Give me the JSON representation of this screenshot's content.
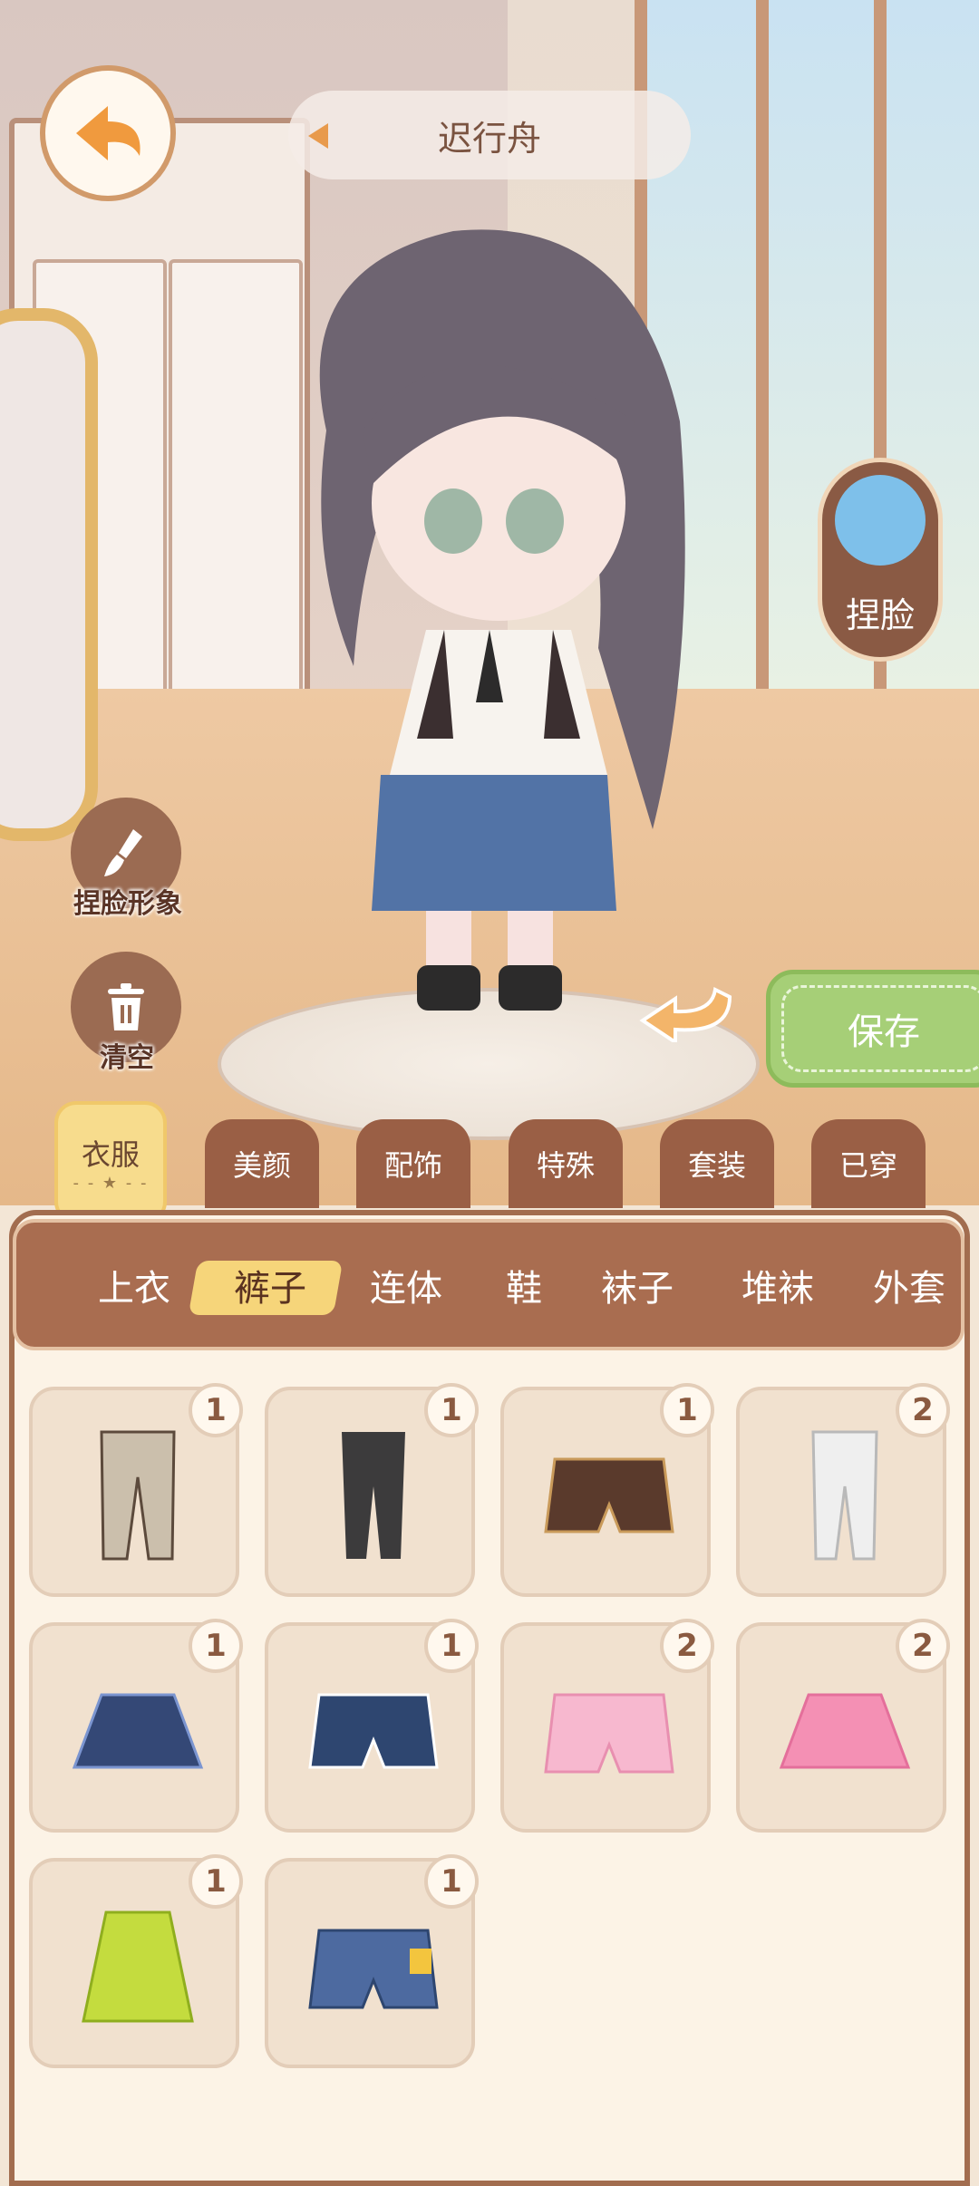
{
  "header": {
    "title": "迟行舟"
  },
  "face_edit": {
    "label": "捏脸"
  },
  "tools": {
    "face_style_label": "捏脸形象",
    "clear_label": "清空"
  },
  "save": {
    "label": "保存"
  },
  "categories": [
    "衣服",
    "美颜",
    "配饰",
    "特殊",
    "套装",
    "已穿"
  ],
  "subcategories": [
    "上衣",
    "裤子",
    "连体",
    "鞋",
    "袜子",
    "堆袜",
    "外套"
  ],
  "items": [
    {
      "name": "plaid-pants",
      "count": "1"
    },
    {
      "name": "black-pants",
      "count": "1"
    },
    {
      "name": "brown-shorts",
      "count": "1"
    },
    {
      "name": "white-lace-pants",
      "count": "2"
    },
    {
      "name": "navy-pleated-skirt",
      "count": "1"
    },
    {
      "name": "navy-shorts",
      "count": "1"
    },
    {
      "name": "pink-shorts",
      "count": "2"
    },
    {
      "name": "pink-plaid-skirt",
      "count": "2"
    },
    {
      "name": "lime-skirt",
      "count": "1"
    },
    {
      "name": "denim-patch-shorts",
      "count": "1"
    }
  ],
  "colors": {
    "accent": "#a96d50",
    "save": "#a6cf77",
    "active_tab": "#f7dc8d"
  }
}
